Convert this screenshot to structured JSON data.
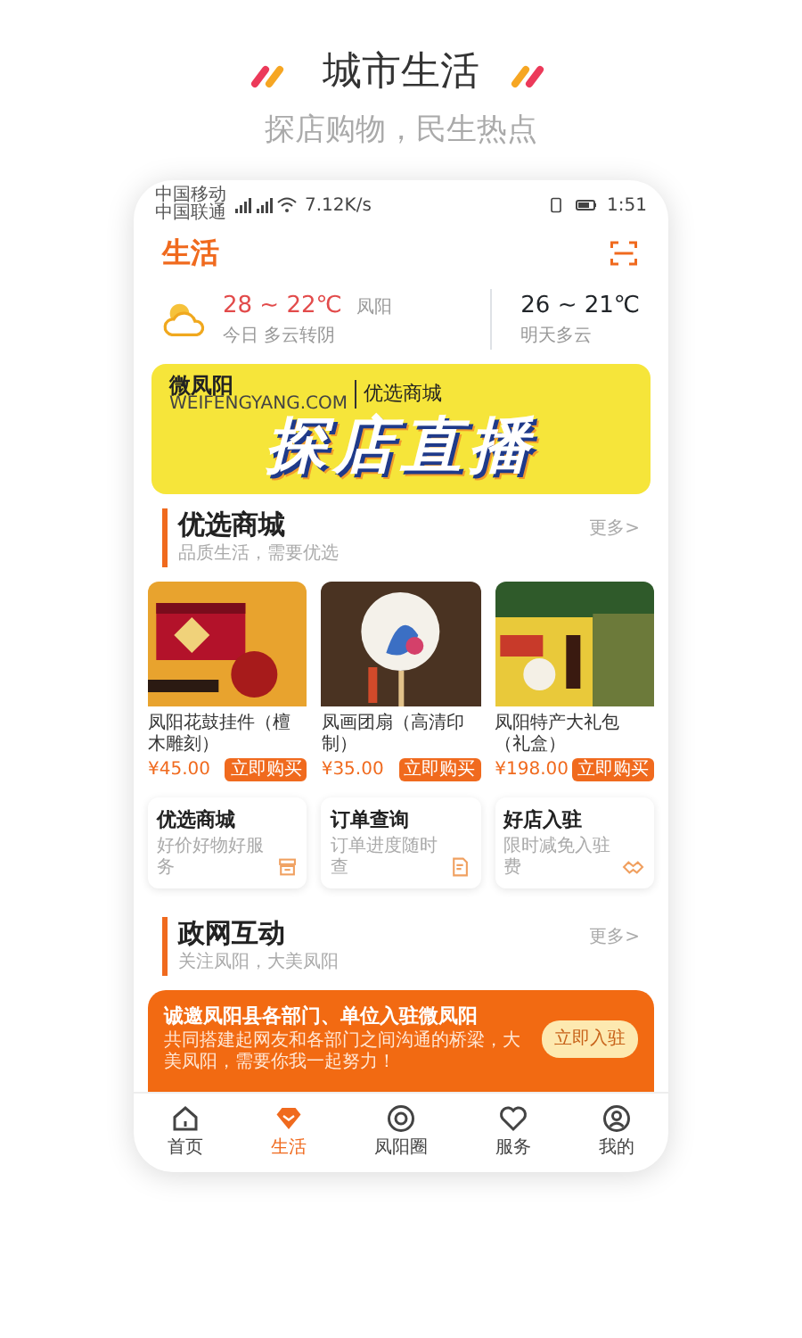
{
  "header": {
    "title": "城市生活",
    "subtitle": "探店购物，民生热点"
  },
  "status_bar": {
    "carriers": [
      "中国移动",
      "中国联通"
    ],
    "speed": "7.12K/s",
    "time": "1:51"
  },
  "app_bar": {
    "title": "生活"
  },
  "weather": {
    "today": {
      "temp": "28 ~ 22℃",
      "place": "凤阳",
      "desc": "今日 多云转阴"
    },
    "tomorrow": {
      "temp": "26 ~ 21℃",
      "desc": "明天多云"
    }
  },
  "banner": {
    "brand": "微凤阳",
    "brand_sub": "WEIFENGYANG.COM",
    "label": "优选商城",
    "headline": "探店直播"
  },
  "shop_section": {
    "title": "优选商城",
    "subtitle": "品质生活，需要优选",
    "more": "更多>"
  },
  "products": [
    {
      "name": "凤阳花鼓挂件（檀木雕刻）",
      "price": "¥45.00",
      "button": "立即购买"
    },
    {
      "name": "凤画团扇（高清印制）",
      "price": "¥35.00",
      "button": "立即购买"
    },
    {
      "name": "凤阳特产大礼包（礼盒）",
      "price": "¥198.00",
      "button": "立即购买"
    }
  ],
  "shortcuts": [
    {
      "title": "优选商城",
      "subtitle": "好价好物好服务",
      "kind": "shop"
    },
    {
      "title": "订单查询",
      "subtitle": "订单进度随时查",
      "kind": "order"
    },
    {
      "title": "好店入驻",
      "subtitle": "限时减免入驻费",
      "kind": "join"
    }
  ],
  "gov_section": {
    "title": "政网互动",
    "subtitle": "关注凤阳，大美凤阳",
    "more": "更多>"
  },
  "promo": {
    "title": "诚邀凤阳县各部门、单位入驻微凤阳",
    "text": "共同搭建起网友和各部门之间沟通的桥梁，大美凤阳，需要你我一起努力！",
    "button": "立即入驻"
  },
  "tabs": [
    {
      "label": "首页",
      "kind": "home",
      "selected": false
    },
    {
      "label": "生活",
      "kind": "life",
      "selected": true
    },
    {
      "label": "凤阳圈",
      "kind": "circle",
      "selected": false
    },
    {
      "label": "服务",
      "kind": "service",
      "selected": false
    },
    {
      "label": "我的",
      "kind": "me",
      "selected": false
    }
  ]
}
